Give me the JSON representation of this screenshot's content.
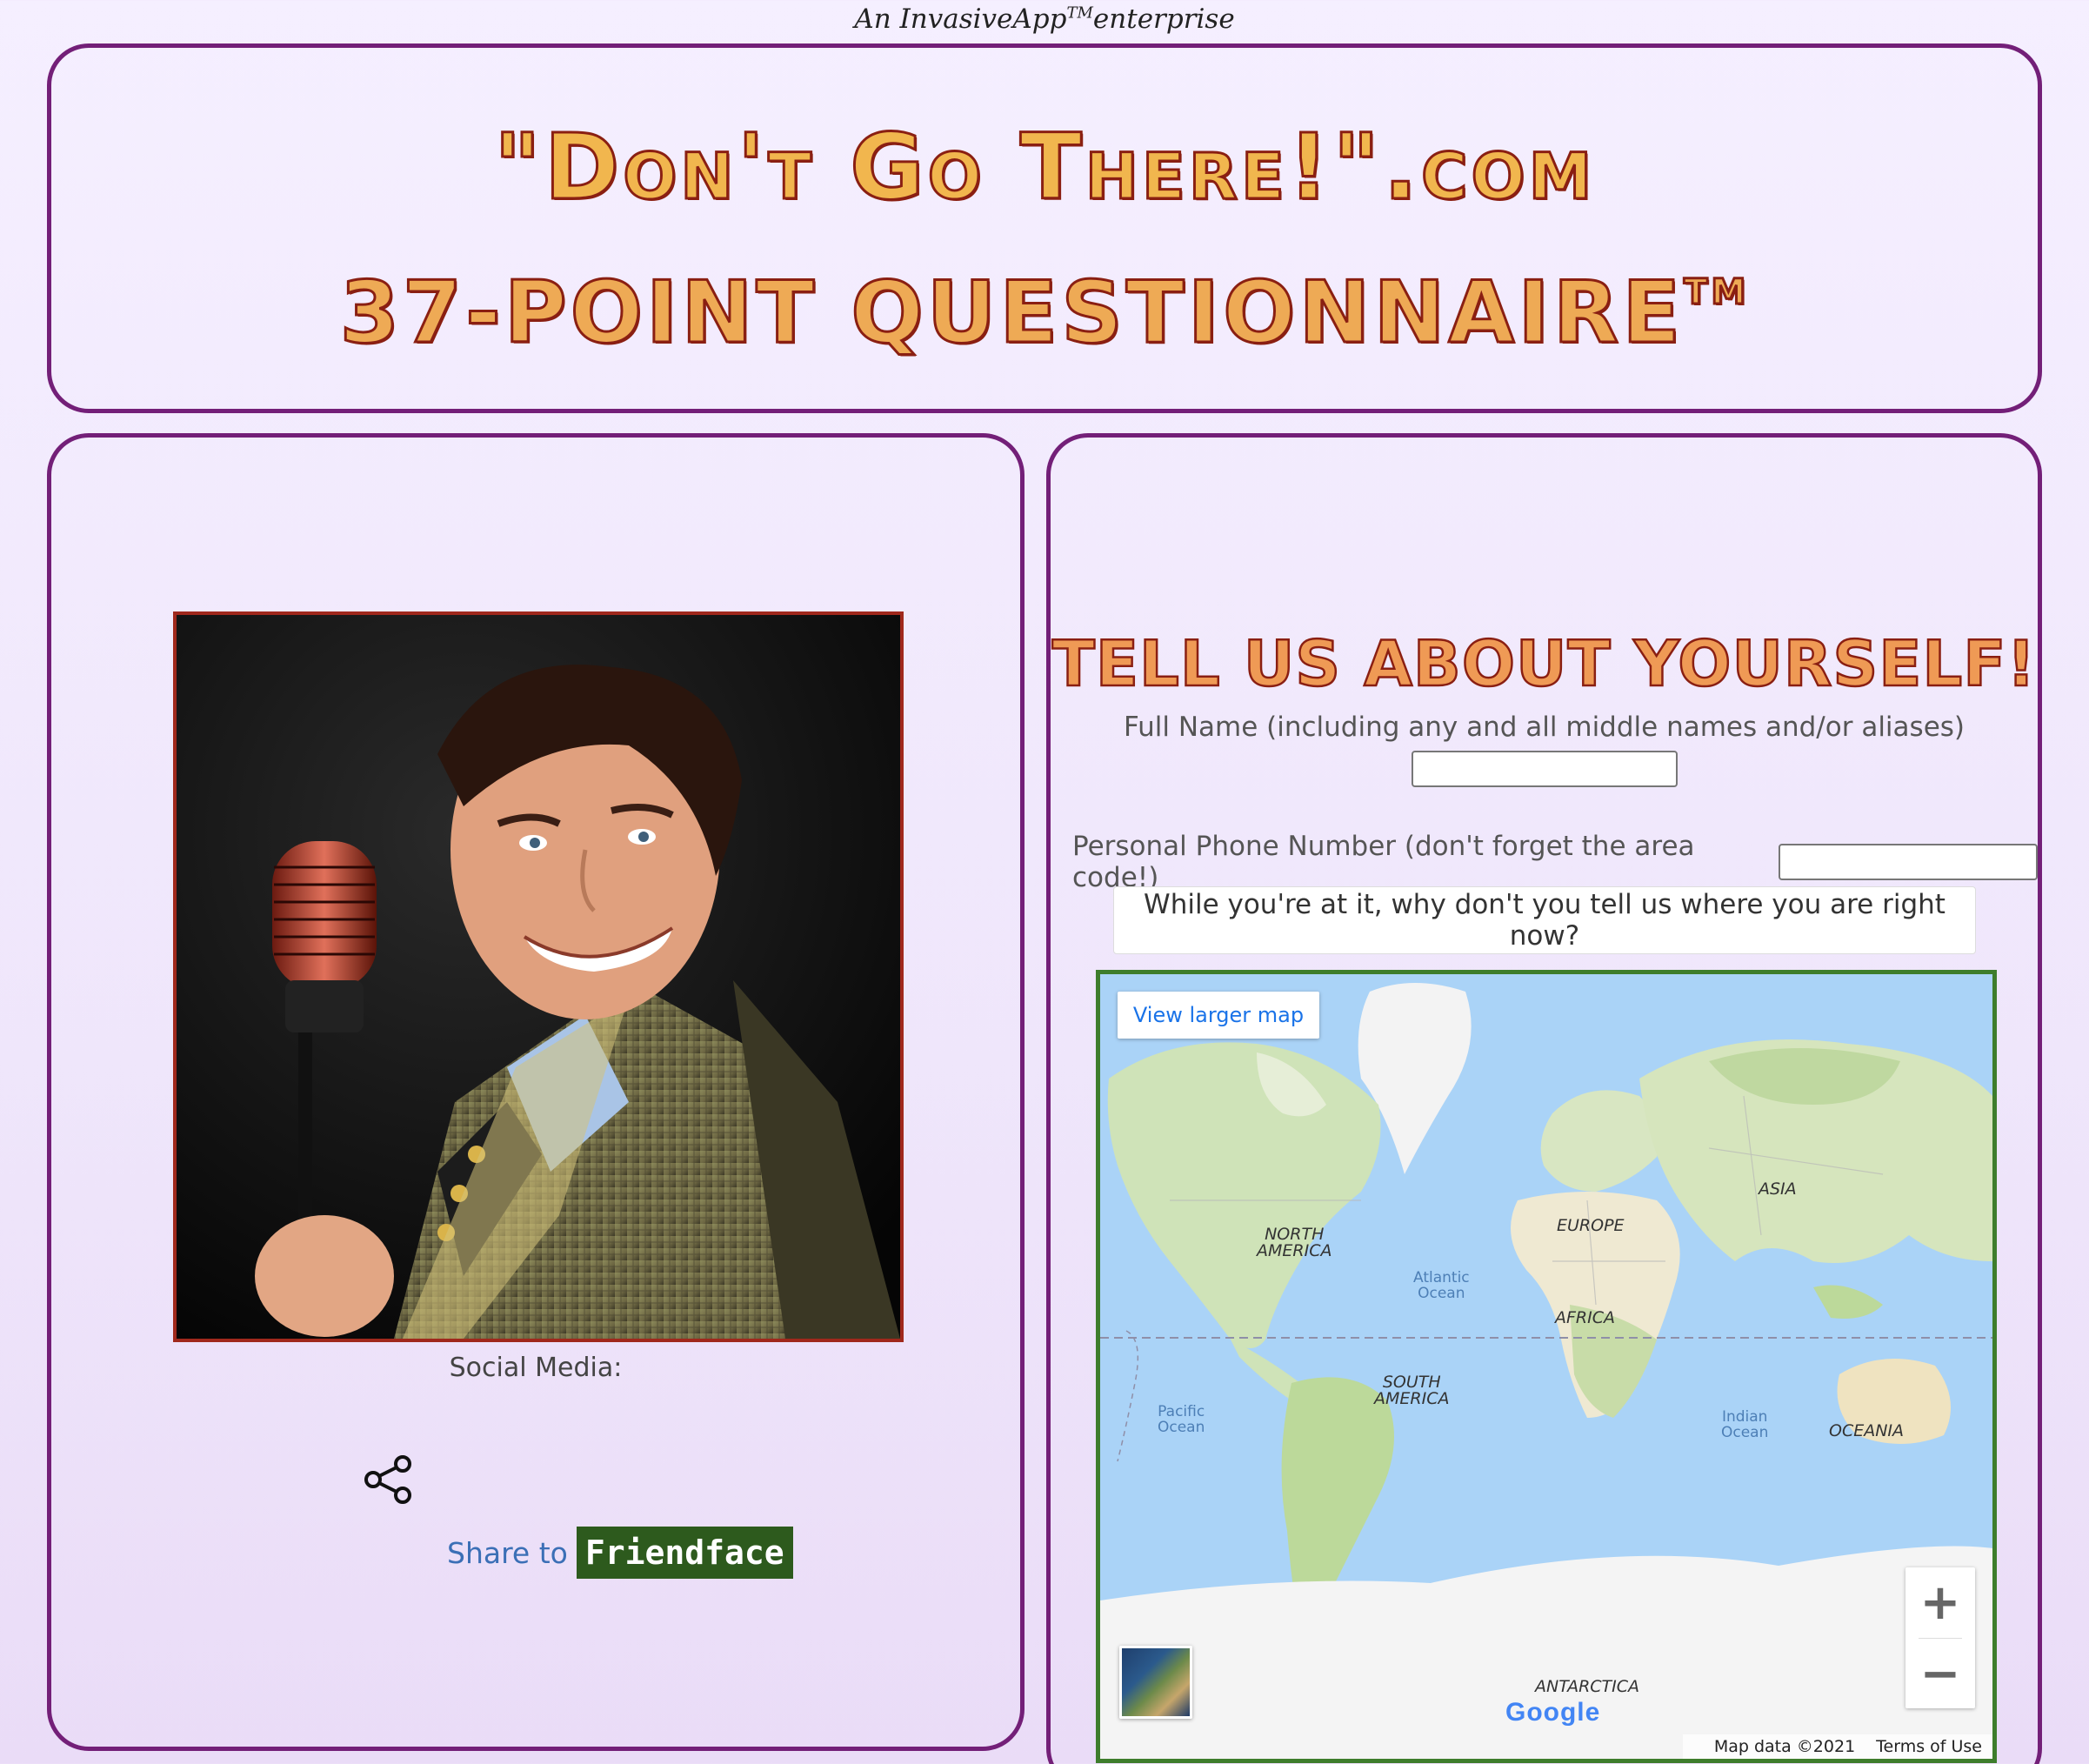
{
  "tagline": {
    "prefix": "An InvasiveApp",
    "tm": "TM",
    "suffix": "enterprise"
  },
  "banner": {
    "line1": "\"Don't Go There!\".com",
    "line2": "37-Point Questionnaire",
    "line2_tm": "TM"
  },
  "left_panel": {
    "social_label": "Social Media:",
    "share_text": "Share to",
    "share_brand": "Friendface"
  },
  "form": {
    "heading": "TELL US ABOUT YOURSELF!",
    "name_label": "Full Name (including any and all middle names and/or aliases)",
    "name_value": "",
    "phone_label": "Personal Phone Number (don't forget the area code!)",
    "phone_value": "",
    "location_button": "While you're at it, why don't you tell us where you are right now?"
  },
  "map": {
    "view_larger": "View larger map",
    "zoom_in": "+",
    "zoom_out": "−",
    "google": "Google",
    "map_data": "Map data ©2021",
    "terms": "Terms of Use",
    "labels": {
      "north_america": "NORTH\nAMERICA",
      "south_america": "SOUTH\nAMERICA",
      "europe": "EUROPE",
      "africa": "AFRICA",
      "asia": "ASIA",
      "oceania": "OCEANIA",
      "antarctica": "ANTARCTICA",
      "atlantic": "Atlantic\nOcean",
      "pacific": "Pacific\nOcean",
      "indian": "Indian\nOcean"
    }
  },
  "colors": {
    "panel_border": "#731f78",
    "banner_fill": "#f1b64e",
    "banner_stroke": "#8a1f12",
    "map_border": "#3e7d2c",
    "friendface_bg": "#2d5a1d",
    "link_blue": "#3b6fb6"
  }
}
